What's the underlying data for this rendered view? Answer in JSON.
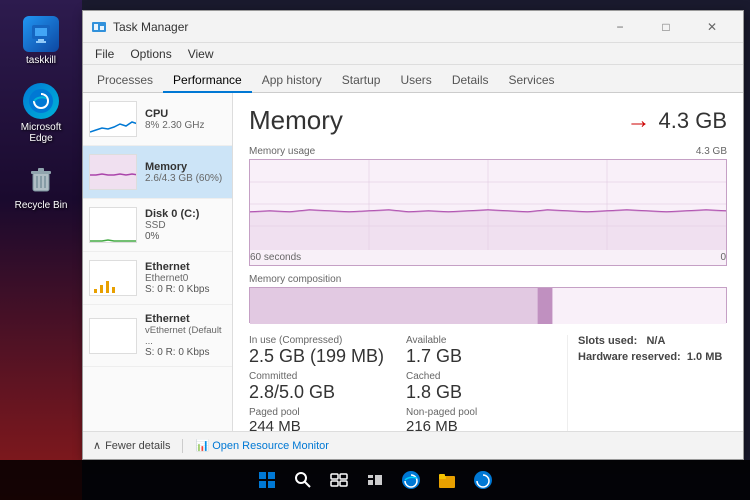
{
  "desktop": {
    "icons": [
      {
        "id": "taskkill",
        "label": "taskkill",
        "color": "#2196F3"
      },
      {
        "id": "edge",
        "label": "Microsoft Edge",
        "color": "#0078d4"
      },
      {
        "id": "recycle",
        "label": "Recycle Bin",
        "color": "transparent"
      }
    ]
  },
  "window": {
    "title": "Task Manager",
    "menubar": [
      "File",
      "Options",
      "View"
    ],
    "tabs": [
      "Processes",
      "Performance",
      "App history",
      "Startup",
      "Users",
      "Details",
      "Services"
    ],
    "active_tab": "Performance"
  },
  "sidebar": {
    "items": [
      {
        "name": "CPU",
        "sub": "8% 2.30 GHz",
        "detail": "",
        "active": false
      },
      {
        "name": "Memory",
        "sub": "2.6/4.3 GB (60%)",
        "detail": "",
        "active": true
      },
      {
        "name": "Disk 0 (C:)",
        "sub": "SSD",
        "detail": "0%",
        "active": false
      },
      {
        "name": "Ethernet",
        "sub": "Ethernet0",
        "detail": "S: 0  R: 0 Kbps",
        "active": false
      },
      {
        "name": "Ethernet",
        "sub": "vEthernet (Default ...",
        "detail": "S: 0  R: 0 Kbps",
        "active": false
      }
    ]
  },
  "content": {
    "title": "Memory",
    "value": "4.3 GB",
    "chart": {
      "usage_label": "Memory usage",
      "max_label": "4.3 GB",
      "time_left": "60 seconds",
      "time_right": "0"
    },
    "composition": {
      "label": "Memory composition"
    },
    "stats": {
      "in_use_label": "In use (Compressed)",
      "in_use_value": "2.5 GB (199 MB)",
      "available_label": "Available",
      "available_value": "1.7 GB",
      "committed_label": "Committed",
      "committed_value": "2.8/5.0 GB",
      "cached_label": "Cached",
      "cached_value": "1.8 GB",
      "paged_label": "Paged pool",
      "paged_value": "244 MB",
      "nonpaged_label": "Non-paged pool",
      "nonpaged_value": "216 MB",
      "slots_label": "Slots used:",
      "slots_value": "N/A",
      "hardware_label": "Hardware reserved:",
      "hardware_value": "1.0 MB"
    }
  },
  "footer": {
    "fewer_label": "Fewer details",
    "monitor_label": "Open Resource Monitor"
  }
}
